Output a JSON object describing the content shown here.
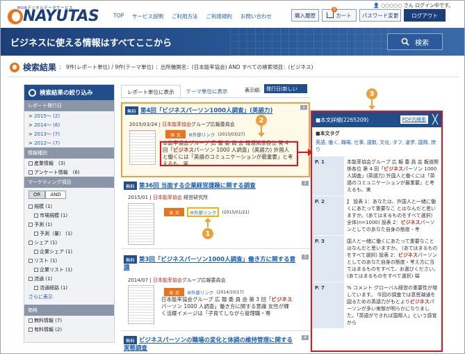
{
  "header": {
    "logo_sub": "MDBデジタルデータサービス",
    "logo_text": "NAYUTAS",
    "nav": [
      "TOP",
      "サービス説明",
      "ご利用方法",
      "ご利用規約",
      "お問い合わせ"
    ],
    "login_user": "○○○○○ ",
    "login_text": "さん ログイン中です。",
    "buttons": {
      "history": "購入履歴",
      "cart": "カート",
      "cart_count": "0",
      "password": "パスワード変更",
      "logout": "ログアウト"
    }
  },
  "banner": {
    "title": "ビジネスに使える情報はすべてここから",
    "search_label": "検索"
  },
  "results": {
    "title": "検索結果",
    "meta": "： 9件(レポート単位) / 9件(テーマ単位) ：出所機関名：(日本能率協会) AND すべての検索項目：(ビジネス)"
  },
  "sidebar": {
    "head": "検索結果の絞り込み",
    "sections": {
      "year": "レポート発行日",
      "type": "情報種別",
      "marketing": "マーケティング項目",
      "price": "価格"
    },
    "years": [
      "2015～ (2)",
      "2014～ (6)",
      "2013～ (7)",
      "2012～ (7)"
    ],
    "types": [
      "産業情報　(3)",
      "アンケート情報　(6)"
    ],
    "toggle": {
      "or": "OR",
      "and": "AND"
    },
    "marketing_items": [
      {
        "label": "規模 (1)",
        "sub": false
      },
      {
        "label": "市場規模 (1)",
        "sub": true
      },
      {
        "label": "予測 (1)",
        "sub": false
      },
      {
        "label": "予測（量） (1)",
        "sub": true
      },
      {
        "label": "シェア (1)",
        "sub": false
      },
      {
        "label": "企業シェア (1)",
        "sub": true
      },
      {
        "label": "リスト (1)",
        "sub": false
      },
      {
        "label": "企業リスト (1)",
        "sub": true
      },
      {
        "label": "流通 (1)",
        "sub": false
      },
      {
        "label": "流通経路 (1)",
        "sub": true
      }
    ],
    "more": "さらに表示",
    "prices": [
      "無料情報 (7)",
      "有料情報 (2)"
    ]
  },
  "tabs": {
    "report": "レポート単位に表示",
    "theme": "テーマ単位に表示",
    "sort_label": "表示順:",
    "sort_value": "発行日(新しい"
  },
  "cards": [
    {
      "num": "1",
      "badge": "無料",
      "title": "第4回「ビジネスパーソン1000人調査」(英語力)",
      "date": "2015/03/24 | ",
      "org": "日本能率協会",
      "org_rest": "グループ広報委員会",
      "hon": "本 文",
      "ext": "外部リンク",
      "ext_date": "(2015/03/27)",
      "snippet_a": "本能率協会グループ 広 報 委 員 会 報道関係各位 第 4 回「",
      "snippet_hl1": "ビジネス",
      "snippet_b": "パーソン 1000 人調査」(英語力) 外国人と働くには「英語のコミュニケーションが最重要」と考えるも、実"
    },
    {
      "num": "2",
      "badge": "無料",
      "title": "第36回 当面する企業経営課題に関する調査",
      "date": "2015/01 | ",
      "org": "日本能率協会",
      "org_rest": " 経営研究所",
      "hon": "本 文",
      "ext": "外部リンク",
      "ext_date": "(2015/01/21)"
    },
    {
      "num": "3",
      "badge": "無料",
      "title": "第3回「ビジネスパーソン1000人調査」働き方に関する意識",
      "date": "2014/07 | ",
      "org": "日本能率協会",
      "org_rest": "グループ広報委員会",
      "hon": "本 文",
      "ext": "外部リンク",
      "ext_date": "(2014/10/17)",
      "snippet_a": "日本能率協会グループ 広 報 委 員 会 第 3 回「",
      "snippet_hl1": "ビジネス",
      "snippet_b": "パーソン 1000 人調査」働き方に関する意識 女性が輝く活躍イメージは「子育てしながら管理職・専"
    },
    {
      "num": "4",
      "badge": "無料",
      "title": "ビジネスパーソンの職場の変化と体調の維持管理に関する実態調査"
    }
  ],
  "panel": {
    "head": "■本文詳細(2265209)",
    "pdf": "PDF内検索",
    "close": "╳",
    "tag_title": "■本文タグ",
    "tags": "英語, 働く, 職場, 仕事, 語数, 文化, タフ, 姿学, 国際, 誇り",
    "pages": [
      {
        "p": "P. 1",
        "a": "本能率協会グループ 広 報 委 員 会 報道関係各位 第 4 回「",
        "hl": "ビジネス",
        "b": "パーソン 1000 人調査」(英語力) 外国人と働くには「英語のコミュニケーションが最重要」と考えるも、実"
      },
      {
        "p": "P. 2",
        "a": "】 設表 1：あなたは、外国人と一緒に働くにあたって重要なこ とはなんだと思いますか。(あてはまるものをすべて選択) 全体(n=1000) 設表 2：",
        "hl": "ビジネス",
        "b": "パーソンとしてのあなた自身の態度・考"
      },
      {
        "p": "P. 3",
        "a": "国人と一緒に働くにあたって重要なこと はなんだと思いますか。 (あてはまるものをすべて選択) 設表 2：",
        "hl": "ビジネス",
        "b": "パーソンとしてのあなた自身の態度・考え方に当 てはまるものをすべて、お選びください。(あてはまるものをすべて選択) 端"
      },
      {
        "p": "P. 7",
        "a": "% コメント グローバル経営の重要性が増しています。 今回の調査では意思疎通を図るための英語力がもとより",
        "hl": "ビジネス",
        "b": "パーソンが多い実態が明らかになりました。「英語ができれば国際人」という感覚から"
      }
    ]
  },
  "markers": {
    "m1": "1",
    "m2": "2",
    "m3": "3"
  }
}
